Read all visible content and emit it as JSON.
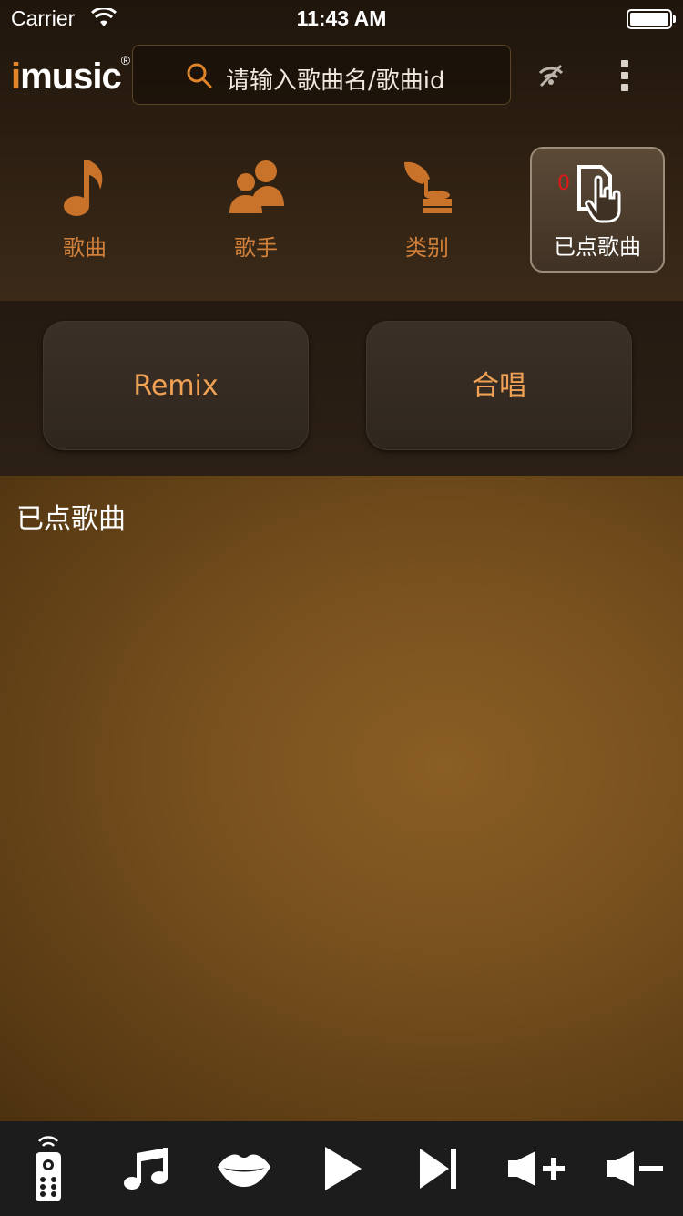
{
  "status_bar": {
    "carrier": "Carrier",
    "time": "11:43 AM"
  },
  "header": {
    "logo_text": "imusic",
    "search": {
      "placeholder": "请输入歌曲名/歌曲id",
      "icon": "search-icon"
    },
    "wifi_icon": "wifi-off-icon",
    "menu_icon": "more-vertical-icon"
  },
  "nav": {
    "items": [
      {
        "label": "歌曲",
        "icon": "music-note-icon"
      },
      {
        "label": "歌手",
        "icon": "singers-icon"
      },
      {
        "label": "类别",
        "icon": "gramophone-icon"
      },
      {
        "label": "已点歌曲",
        "icon": "tap-document-icon",
        "count": "0",
        "selected": true
      }
    ]
  },
  "modes": {
    "remix": "Remix",
    "chorus": "合唱"
  },
  "content": {
    "title": "已点歌曲"
  },
  "controls": [
    {
      "icon": "remote-icon"
    },
    {
      "icon": "music-notes-icon"
    },
    {
      "icon": "lips-icon"
    },
    {
      "icon": "play-icon"
    },
    {
      "icon": "next-track-icon"
    },
    {
      "icon": "volume-up-icon"
    },
    {
      "icon": "volume-down-icon"
    }
  ],
  "colors": {
    "accent": "#e0852a",
    "nav_label": "#d0803a",
    "mode_label": "#f0a154",
    "count": "#e01818"
  }
}
